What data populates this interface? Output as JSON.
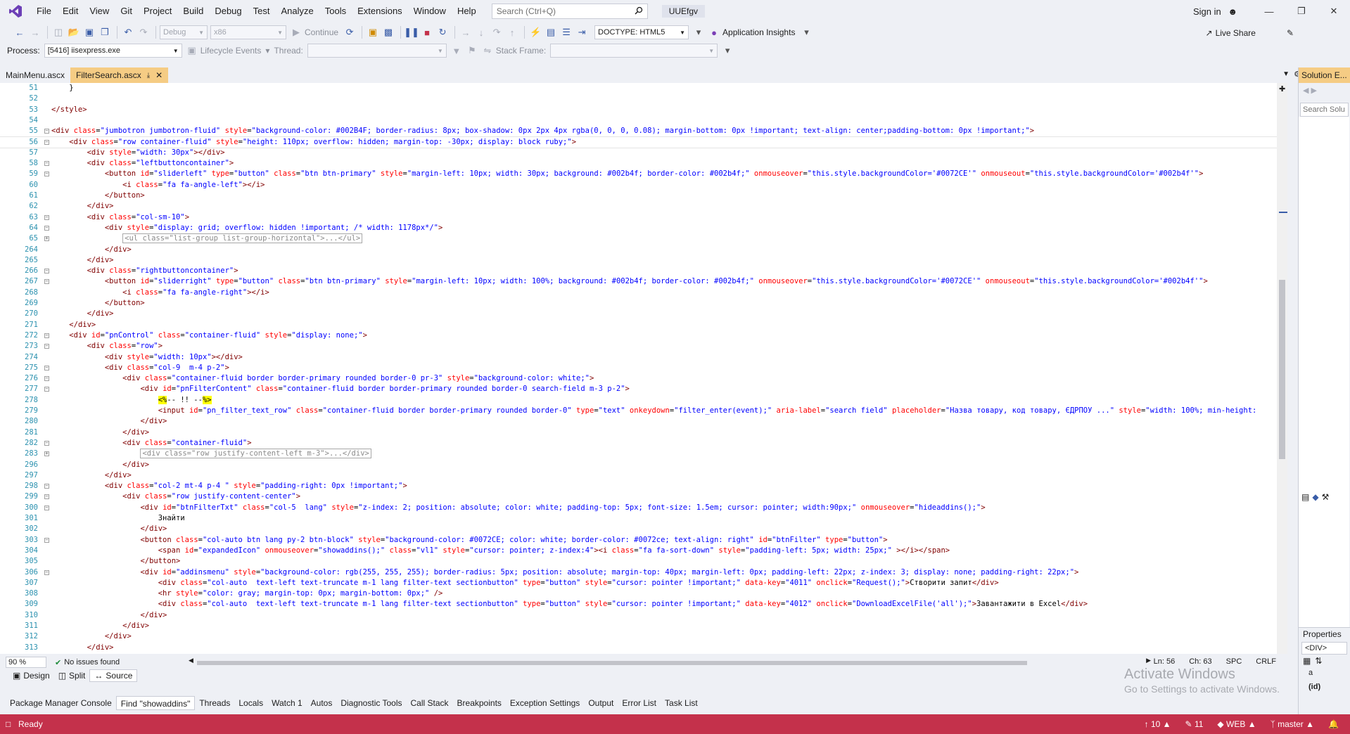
{
  "menu": [
    "File",
    "Edit",
    "View",
    "Git",
    "Project",
    "Build",
    "Debug",
    "Test",
    "Analyze",
    "Tools",
    "Extensions",
    "Window",
    "Help"
  ],
  "search_placeholder": "Search (Ctrl+Q)",
  "solution_name": "UUEfgv",
  "sign_in": "Sign in",
  "toolbar": {
    "config": "Debug",
    "platform": "x86",
    "continue_label": "Continue",
    "doctype": "DOCTYPE: HTML5",
    "app_insights": "Application Insights",
    "live_share": "Live Share"
  },
  "debug_toolbar": {
    "process_label": "Process:",
    "process_value": "[5416] iisexpress.exe",
    "lifecycle": "Lifecycle Events",
    "thread_label": "Thread:",
    "stack_frame_label": "Stack Frame:"
  },
  "tabs": [
    {
      "label": "MainMenu.ascx",
      "active": false
    },
    {
      "label": "FilterSearch.ascx",
      "active": true
    }
  ],
  "code": [
    {
      "n": "51",
      "fold": "",
      "html": "    }"
    },
    {
      "n": "52",
      "fold": "",
      "html": ""
    },
    {
      "n": "53",
      "fold": "",
      "html": "<span class=\"tg\">&lt;/style&gt;</span>"
    },
    {
      "n": "54",
      "fold": "",
      "html": ""
    },
    {
      "n": "55",
      "fold": "-",
      "html": "<span class=\"tg\">&lt;div</span> <span class=\"at\">class</span>=<span class=\"vl\">\"jumbotron jumbotron-fluid\"</span> <span class=\"at\">style</span>=<span class=\"vl\">\"background-color: #002B4F; border-radius: 8px; box-shadow: 0px 2px 4px rgba(0, 0, 0, 0.08); margin-bottom: 0px !important; text-align: center;padding-bottom: 0px !important;\"</span><span class=\"tg\">&gt;</span>"
    },
    {
      "n": "56",
      "fold": "-",
      "cur": true,
      "html": "    <span class=\"tg\">&lt;div</span> <span class=\"at\">class</span>=<span class=\"vl\">\"row container-fluid\"</span> <span class=\"at\">style</span>=<span class=\"vl\">\"height: 110px; overflow: hidden; margin-top: -30px; display: block ruby;\"</span><span class=\"tg\">&gt;</span>"
    },
    {
      "n": "57",
      "fold": "",
      "html": "        <span class=\"tg\">&lt;div</span> <span class=\"at\">style</span>=<span class=\"vl\">\"width: 30px\"</span><span class=\"tg\">&gt;&lt;/div&gt;</span>"
    },
    {
      "n": "58",
      "fold": "-",
      "html": "        <span class=\"tg\">&lt;div</span> <span class=\"at\">class</span>=<span class=\"vl\">\"leftbuttoncontainer\"</span><span class=\"tg\">&gt;</span>"
    },
    {
      "n": "59",
      "fold": "-",
      "html": "            <span class=\"tg\">&lt;button</span> <span class=\"at\">id</span>=<span class=\"vl\">\"sliderleft\"</span> <span class=\"at\">type</span>=<span class=\"vl\">\"button\"</span> <span class=\"at\">class</span>=<span class=\"vl\">\"btn btn-primary\"</span> <span class=\"at\">style</span>=<span class=\"vl\">\"margin-left: 10px; width: 30px; background: #002b4f; border-color: #002b4f;\"</span> <span class=\"at\">onmouseover</span>=<span class=\"vl\">\"this.style.backgroundColor='#0072CE'\"</span> <span class=\"at\">onmouseout</span>=<span class=\"vl\">\"this.style.backgroundColor='#002b4f'\"</span><span class=\"tg\">&gt;</span>"
    },
    {
      "n": "60",
      "fold": "",
      "html": "                <span class=\"tg\">&lt;i</span> <span class=\"at\">class</span>=<span class=\"vl\">\"fa fa-angle-left\"</span><span class=\"tg\">&gt;&lt;/i&gt;</span>"
    },
    {
      "n": "61",
      "fold": "",
      "html": "            <span class=\"tg\">&lt;/button&gt;</span>"
    },
    {
      "n": "62",
      "fold": "",
      "html": "        <span class=\"tg\">&lt;/div&gt;</span>"
    },
    {
      "n": "63",
      "fold": "-",
      "html": "        <span class=\"tg\">&lt;div</span> <span class=\"at\">class</span>=<span class=\"vl\">\"col-sm-10\"</span><span class=\"tg\">&gt;</span>"
    },
    {
      "n": "64",
      "fold": "-",
      "html": "            <span class=\"tg\">&lt;div</span> <span class=\"at\">style</span>=<span class=\"vl\">\"display: grid; overflow: hidden !important; /* width: 1178px*/\"</span><span class=\"tg\">&gt;</span>"
    },
    {
      "n": "65",
      "fold": "+",
      "html": "                <span class=\"collapsed\">&lt;ul class=\"list-group list-group-horizontal\"&gt;...&lt;/ul&gt;</span>"
    },
    {
      "n": "264",
      "fold": "",
      "html": "            <span class=\"tg\">&lt;/div&gt;</span>"
    },
    {
      "n": "265",
      "fold": "",
      "html": "        <span class=\"tg\">&lt;/div&gt;</span>"
    },
    {
      "n": "266",
      "fold": "-",
      "html": "        <span class=\"tg\">&lt;div</span> <span class=\"at\">class</span>=<span class=\"vl\">\"rightbuttoncontainer\"</span><span class=\"tg\">&gt;</span>"
    },
    {
      "n": "267",
      "fold": "-",
      "html": "            <span class=\"tg\">&lt;button</span> <span class=\"at\">id</span>=<span class=\"vl\">\"sliderright\"</span> <span class=\"at\">type</span>=<span class=\"vl\">\"button\"</span> <span class=\"at\">class</span>=<span class=\"vl\">\"btn btn-primary\"</span> <span class=\"at\">style</span>=<span class=\"vl\">\"margin-left: 10px; width: 100%; background: #002b4f; border-color: #002b4f;\"</span> <span class=\"at\">onmouseover</span>=<span class=\"vl\">\"this.style.backgroundColor='#0072CE'\"</span> <span class=\"at\">onmouseout</span>=<span class=\"vl\">\"this.style.backgroundColor='#002b4f'\"</span><span class=\"tg\">&gt;</span>"
    },
    {
      "n": "268",
      "fold": "",
      "html": "                <span class=\"tg\">&lt;i</span> <span class=\"at\">class</span>=<span class=\"vl\">\"fa fa-angle-right\"</span><span class=\"tg\">&gt;&lt;/i&gt;</span>"
    },
    {
      "n": "269",
      "fold": "",
      "html": "            <span class=\"tg\">&lt;/button&gt;</span>"
    },
    {
      "n": "270",
      "fold": "",
      "html": "        <span class=\"tg\">&lt;/div&gt;</span>"
    },
    {
      "n": "271",
      "fold": "",
      "html": "    <span class=\"tg\">&lt;/div&gt;</span>"
    },
    {
      "n": "272",
      "fold": "-",
      "html": "    <span class=\"tg\">&lt;div</span> <span class=\"at\">id</span>=<span class=\"vl\">\"pnControl\"</span> <span class=\"at\">class</span>=<span class=\"vl\">\"container-fluid\"</span> <span class=\"at\">style</span>=<span class=\"vl\">\"display: none;\"</span><span class=\"tg\">&gt;</span>"
    },
    {
      "n": "273",
      "fold": "-",
      "html": "        <span class=\"tg\">&lt;div</span> <span class=\"at\">class</span>=<span class=\"vl\">\"row\"</span><span class=\"tg\">&gt;</span>"
    },
    {
      "n": "274",
      "fold": "",
      "html": "            <span class=\"tg\">&lt;div</span> <span class=\"at\">style</span>=<span class=\"vl\">\"width: 10px\"</span><span class=\"tg\">&gt;&lt;/div&gt;</span>"
    },
    {
      "n": "275",
      "fold": "-",
      "html": "            <span class=\"tg\">&lt;div</span> <span class=\"at\">class</span>=<span class=\"vl\">\"col-9  m-4 p-2\"</span><span class=\"tg\">&gt;</span>"
    },
    {
      "n": "276",
      "fold": "-",
      "html": "                <span class=\"tg\">&lt;div</span> <span class=\"at\">class</span>=<span class=\"vl\">\"container-fluid border border-primary rounded border-0 pr-3\"</span> <span class=\"at\">style</span>=<span class=\"vl\">\"background-color: white;\"</span><span class=\"tg\">&gt;</span>"
    },
    {
      "n": "277",
      "fold": "-",
      "html": "                    <span class=\"tg\">&lt;div</span> <span class=\"at\">id</span>=<span class=\"vl\">\"pnFilterContent\"</span> <span class=\"at\">class</span>=<span class=\"vl\">\"container-fluid border border-primary rounded border-0 search-field m-3 p-2\"</span><span class=\"tg\">&gt;</span>"
    },
    {
      "n": "278",
      "fold": "",
      "html": "                        <span class=\"hl\">&lt;%</span>-- !! --<span class=\"hl\">%&gt;</span>"
    },
    {
      "n": "279",
      "fold": "",
      "html": "                        <span class=\"tg\">&lt;input</span> <span class=\"at\">id</span>=<span class=\"vl\">\"pn_filter_text_row\"</span> <span class=\"at\">class</span>=<span class=\"vl\">\"container-fluid border border-primary rounded border-0\"</span> <span class=\"at\">type</span>=<span class=\"vl\">\"text\"</span> <span class=\"at\">onkeydown</span>=<span class=\"vl\">\"filter_enter(event);\"</span> <span class=\"at\">aria-label</span>=<span class=\"vl\">\"search field\"</span> <span class=\"at\">placeholder</span>=<span class=\"vl\">\"Назва товару, код товару, ЄДРПОУ ...\"</span> <span class=\"at\">style</span>=<span class=\"vl\">\"width: 100%; min-height:</span>"
    },
    {
      "n": "280",
      "fold": "",
      "html": "                    <span class=\"tg\">&lt;/div&gt;</span>"
    },
    {
      "n": "281",
      "fold": "",
      "html": "                <span class=\"tg\">&lt;/div&gt;</span>"
    },
    {
      "n": "282",
      "fold": "-",
      "html": "                <span class=\"tg\">&lt;div</span> <span class=\"at\">class</span>=<span class=\"vl\">\"container-fluid\"</span><span class=\"tg\">&gt;</span>"
    },
    {
      "n": "283",
      "fold": "+",
      "html": "                    <span class=\"collapsed\">&lt;div class=\"row justify-content-left m-3\"&gt;...&lt;/div&gt;</span>"
    },
    {
      "n": "296",
      "fold": "",
      "html": "                <span class=\"tg\">&lt;/div&gt;</span>"
    },
    {
      "n": "297",
      "fold": "",
      "html": "            <span class=\"tg\">&lt;/div&gt;</span>"
    },
    {
      "n": "298",
      "fold": "-",
      "html": "            <span class=\"tg\">&lt;div</span> <span class=\"at\">class</span>=<span class=\"vl\">\"col-2 mt-4 p-4 \"</span> <span class=\"at\">style</span>=<span class=\"vl\">\"padding-right: 0px !important;\"</span><span class=\"tg\">&gt;</span>"
    },
    {
      "n": "299",
      "fold": "-",
      "html": "                <span class=\"tg\">&lt;div</span> <span class=\"at\">class</span>=<span class=\"vl\">\"row justify-content-center\"</span><span class=\"tg\">&gt;</span>"
    },
    {
      "n": "300",
      "fold": "-",
      "html": "                    <span class=\"tg\">&lt;div</span> <span class=\"at\">id</span>=<span class=\"vl\">\"btnFilterTxt\"</span> <span class=\"at\">class</span>=<span class=\"vl\">\"col-5  lang\"</span> <span class=\"at\">style</span>=<span class=\"vl\">\"z-index: 2; position: absolute; color: white; padding-top: 5px; font-size: 1.5em; cursor: pointer; width:90px;\"</span> <span class=\"at\">onmouseover</span>=<span class=\"vl\">\"hideaddins();\"</span><span class=\"tg\">&gt;</span>"
    },
    {
      "n": "301",
      "fold": "",
      "html": "                        Знайти"
    },
    {
      "n": "302",
      "fold": "",
      "html": "                    <span class=\"tg\">&lt;/div&gt;</span>"
    },
    {
      "n": "303",
      "fold": "-",
      "html": "                    <span class=\"tg\">&lt;button</span> <span class=\"at\">class</span>=<span class=\"vl\">\"col-auto btn lang py-2 btn-block\"</span> <span class=\"at\">style</span>=<span class=\"vl\">\"background-color: #0072CE; color: white; border-color: #0072ce; text-align: right\"</span> <span class=\"at\">id</span>=<span class=\"vl\">\"btnFilter\"</span> <span class=\"at\">type</span>=<span class=\"vl\">\"button\"</span><span class=\"tg\">&gt;</span>"
    },
    {
      "n": "304",
      "fold": "",
      "html": "                        <span class=\"tg\">&lt;span</span> <span class=\"at\">id</span>=<span class=\"vl\">\"expandedIcon\"</span> <span class=\"at\">onmouseover</span>=<span class=\"vl\">\"showaddins();\"</span> <span class=\"at\">class</span>=<span class=\"vl\">\"vl1\"</span> <span class=\"at\">style</span>=<span class=\"vl\">\"cursor: pointer; z-index:4\"</span><span class=\"tg\">&gt;&lt;i</span> <span class=\"at\">class</span>=<span class=\"vl\">\"fa fa-sort-down\"</span> <span class=\"at\">style</span>=<span class=\"vl\">\"padding-left: 5px; width: 25px;\"</span> <span class=\"tg\">&gt;&lt;/i&gt;&lt;/span&gt;</span>"
    },
    {
      "n": "305",
      "fold": "",
      "html": "                    <span class=\"tg\">&lt;/button&gt;</span>"
    },
    {
      "n": "306",
      "fold": "-",
      "html": "                    <span class=\"tg\">&lt;div</span> <span class=\"at\">id</span>=<span class=\"vl\">\"addinsmenu\"</span> <span class=\"at\">style</span>=<span class=\"vl\">\"background-color: rgb(255, 255, 255); border-radius: 5px; position: absolute; margin-top: 40px; margin-left: 0px; padding-left: 22px; z-index: 3; display: none; padding-right: 22px;\"</span><span class=\"tg\">&gt;</span>"
    },
    {
      "n": "307",
      "fold": "",
      "html": "                        <span class=\"tg\">&lt;div</span> <span class=\"at\">class</span>=<span class=\"vl\">\"col-auto  text-left text-truncate m-1 lang filter-text sectionbutton\"</span> <span class=\"at\">type</span>=<span class=\"vl\">\"button\"</span> <span class=\"at\">style</span>=<span class=\"vl\">\"cursor: pointer !important;\"</span> <span class=\"at\">data-key</span>=<span class=\"vl\">\"4011\"</span> <span class=\"at\">onclick</span>=<span class=\"vl\">\"Request();\"</span><span class=\"tg\">&gt;</span>Створити запит<span class=\"tg\">&lt;/div&gt;</span>"
    },
    {
      "n": "308",
      "fold": "",
      "html": "                        <span class=\"tg\">&lt;hr</span> <span class=\"at\">style</span>=<span class=\"vl\">\"color: gray; margin-top: 0px; margin-bottom: 0px;\"</span> <span class=\"tg\">/&gt;</span>"
    },
    {
      "n": "309",
      "fold": "",
      "html": "                        <span class=\"tg\">&lt;div</span> <span class=\"at\">class</span>=<span class=\"vl\">\"col-auto  text-left text-truncate m-1 lang filter-text sectionbutton\"</span> <span class=\"at\">type</span>=<span class=\"vl\">\"button\"</span> <span class=\"at\">style</span>=<span class=\"vl\">\"cursor: pointer !important;\"</span> <span class=\"at\">data-key</span>=<span class=\"vl\">\"4012\"</span> <span class=\"at\">onclick</span>=<span class=\"vl\">\"DownloadExcelFile('all');\"</span><span class=\"tg\">&gt;</span>Завантажити в Excel<span class=\"tg\">&lt;/div&gt;</span>"
    },
    {
      "n": "310",
      "fold": "",
      "html": "                    <span class=\"tg\">&lt;/div&gt;</span>"
    },
    {
      "n": "311",
      "fold": "",
      "html": "                <span class=\"tg\">&lt;/div&gt;</span>"
    },
    {
      "n": "312",
      "fold": "",
      "html": "            <span class=\"tg\">&lt;/div&gt;</span>"
    },
    {
      "n": "313",
      "fold": "",
      "html": "        <span class=\"tg\">&lt;/div&gt;</span>"
    }
  ],
  "editor_status": {
    "zoom": "90 %",
    "issues": "No issues found",
    "ln": "Ln: 56",
    "ch": "Ch: 63",
    "spc": "SPC",
    "crlf": "CRLF"
  },
  "view_tabs": [
    "Design",
    "Split",
    "Source"
  ],
  "activate": {
    "line1": "Activate Windows",
    "line2": "Go to Settings to activate Windows."
  },
  "bottom_tabs": [
    {
      "label": "Package Manager Console",
      "active": false
    },
    {
      "label": "Find \"showaddins\"",
      "active": true
    },
    {
      "label": "Threads",
      "active": false
    },
    {
      "label": "Locals",
      "active": false
    },
    {
      "label": "Watch 1",
      "active": false
    },
    {
      "label": "Autos",
      "active": false
    },
    {
      "label": "Diagnostic Tools",
      "active": false
    },
    {
      "label": "Call Stack",
      "active": false
    },
    {
      "label": "Breakpoints",
      "active": false
    },
    {
      "label": "Exception Settings",
      "active": false
    },
    {
      "label": "Output",
      "active": false
    },
    {
      "label": "Error List",
      "active": false
    },
    {
      "label": "Task List",
      "active": false
    }
  ],
  "status_bar": {
    "ready": "Ready",
    "up_count": "10",
    "pencil_count": "11",
    "repo": "WEB",
    "branch": "master",
    "bg": "#c4314b"
  },
  "solution_explorer": {
    "title": "Solution E...",
    "search": "Search Solu"
  },
  "properties": {
    "title": "Properties",
    "combo": "<DIV>",
    "row1": "a",
    "row2": "(id)"
  }
}
